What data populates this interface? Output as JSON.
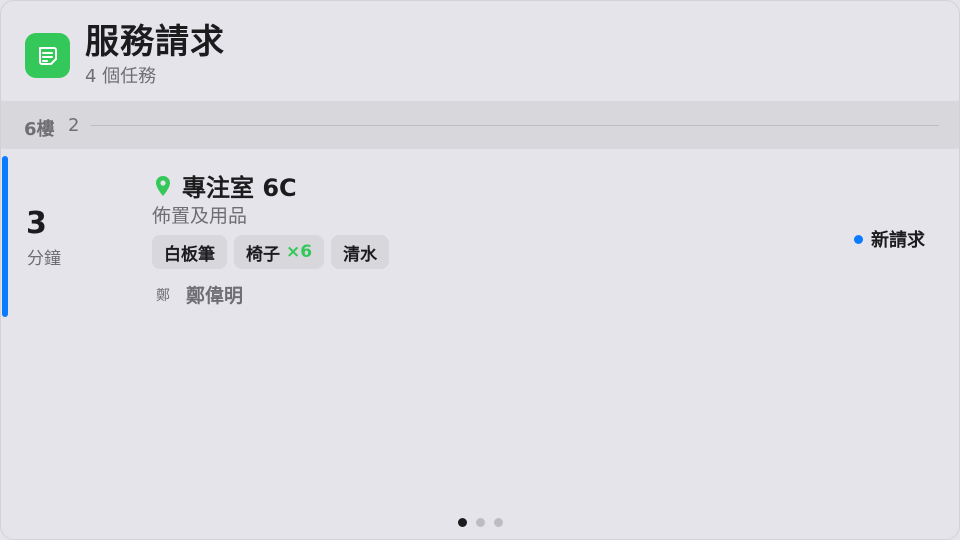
{
  "header": {
    "title": "服務請求",
    "subtitle": "4 個任務",
    "icon": "note-icon",
    "accent_color": "#34c759"
  },
  "floor_section": {
    "label": "6樓",
    "count": "2"
  },
  "requests": [
    {
      "eta_value": "3",
      "eta_unit": "分鐘",
      "location": "專注室 6C",
      "category": "佈置及用品",
      "items": [
        {
          "name": "白板筆",
          "qty": ""
        },
        {
          "name": "椅子",
          "qty": "×6"
        },
        {
          "name": "清水",
          "qty": ""
        }
      ],
      "requester_avatar": "鄭",
      "requester_name": "鄭偉明",
      "status": "新請求",
      "status_color": "#0a7aff"
    }
  ],
  "pager": {
    "pages": 3,
    "current": 1
  }
}
